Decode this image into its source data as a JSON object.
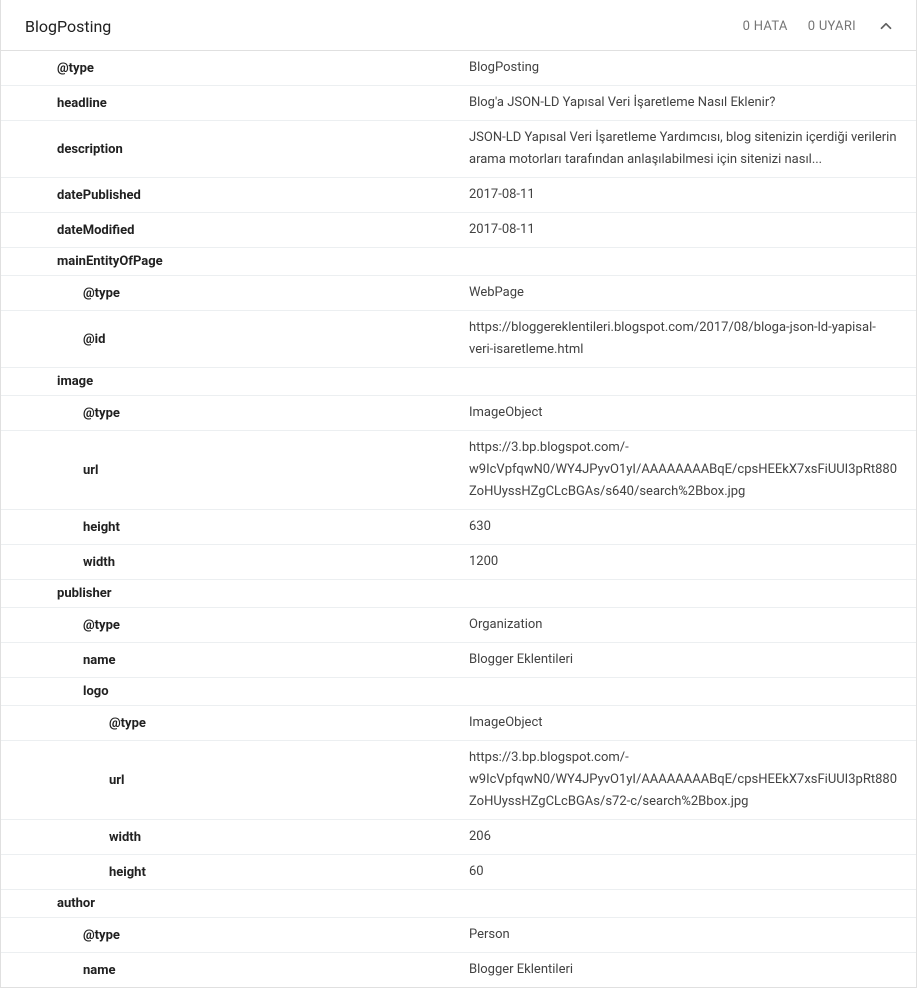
{
  "header": {
    "title": "BlogPosting",
    "errors": "0 HATA",
    "warnings": "0 UYARI"
  },
  "rows": [
    {
      "indent": 1,
      "key": "@type",
      "val": "BlogPosting"
    },
    {
      "indent": 1,
      "key": "headline",
      "val": "Blog'a JSON-LD Yapısal Veri İşaretleme Nasıl Eklenir?"
    },
    {
      "indent": 1,
      "key": "description",
      "val": "JSON-LD Yapısal Veri İşaretleme Yardımcısı, blog sitenizin içerdiği verilerin arama motorları tarafından anlaşılabilmesi için sitenizi nasıl..."
    },
    {
      "indent": 1,
      "key": "datePublished",
      "val": "2017-08-11"
    },
    {
      "indent": 1,
      "key": "dateModified",
      "val": "2017-08-11"
    },
    {
      "indent": 1,
      "key": "mainEntityOfPage",
      "val": ""
    },
    {
      "indent": 2,
      "key": "@type",
      "val": "WebPage"
    },
    {
      "indent": 2,
      "key": "@id",
      "val": "https://bloggereklentileri.blogspot.com/2017/08/bloga-json-ld-yapisal-veri-isaretleme.html"
    },
    {
      "indent": 1,
      "key": "image",
      "val": ""
    },
    {
      "indent": 2,
      "key": "@type",
      "val": "ImageObject"
    },
    {
      "indent": 2,
      "key": "url",
      "val": "https://3.bp.blogspot.com/-w9IcVpfqwN0/WY4JPyvO1yI/AAAAAAAABqE/cpsHEEkX7xsFiUUI3pRt880ZoHUyssHZgCLcBGAs/s640/search%2Bbox.jpg"
    },
    {
      "indent": 2,
      "key": "height",
      "val": "630"
    },
    {
      "indent": 2,
      "key": "width",
      "val": "1200"
    },
    {
      "indent": 1,
      "key": "publisher",
      "val": ""
    },
    {
      "indent": 2,
      "key": "@type",
      "val": "Organization"
    },
    {
      "indent": 2,
      "key": "name",
      "val": "Blogger Eklentileri"
    },
    {
      "indent": 2,
      "key": "logo",
      "val": ""
    },
    {
      "indent": 3,
      "key": "@type",
      "val": "ImageObject"
    },
    {
      "indent": 3,
      "key": "url",
      "val": "https://3.bp.blogspot.com/-w9IcVpfqwN0/WY4JPyvO1yI/AAAAAAAABqE/cpsHEEkX7xsFiUUI3pRt880ZoHUyssHZgCLcBGAs/s72-c/search%2Bbox.jpg"
    },
    {
      "indent": 3,
      "key": "width",
      "val": "206"
    },
    {
      "indent": 3,
      "key": "height",
      "val": "60"
    },
    {
      "indent": 1,
      "key": "author",
      "val": ""
    },
    {
      "indent": 2,
      "key": "@type",
      "val": "Person"
    },
    {
      "indent": 2,
      "key": "name",
      "val": "Blogger Eklentileri"
    }
  ]
}
